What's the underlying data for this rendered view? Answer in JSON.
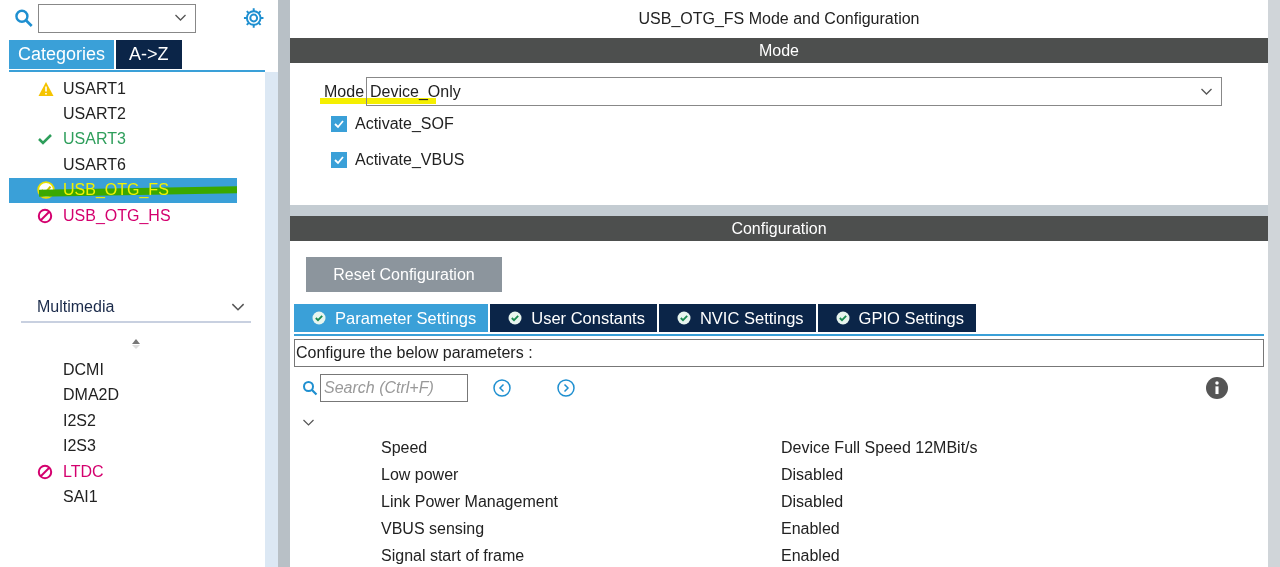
{
  "sidebar": {
    "tabs": [
      {
        "label": "Categories",
        "selected": true
      },
      {
        "label": "A->Z",
        "selected": false
      }
    ],
    "items": [
      {
        "label": "USART1",
        "kind": "warning",
        "selected": false,
        "highlighted": false
      },
      {
        "label": "USART2",
        "kind": "plain",
        "selected": false,
        "highlighted": false
      },
      {
        "label": "USART3",
        "kind": "ok",
        "selected": false,
        "highlighted": false
      },
      {
        "label": "USART6",
        "kind": "plain",
        "selected": false,
        "highlighted": false
      },
      {
        "label": "USB_OTG_FS",
        "kind": "ok",
        "selected": true,
        "highlighted": true
      },
      {
        "label": "USB_OTG_HS",
        "kind": "blocked",
        "selected": false,
        "highlighted": false
      }
    ],
    "group": {
      "label": "Multimedia",
      "expanded": true,
      "items": [
        {
          "label": "DCMI",
          "kind": "plain"
        },
        {
          "label": "DMA2D",
          "kind": "plain"
        },
        {
          "label": "I2S2",
          "kind": "plain"
        },
        {
          "label": "I2S3",
          "kind": "plain"
        },
        {
          "label": "LTDC",
          "kind": "blocked"
        },
        {
          "label": "SAI1",
          "kind": "plain"
        }
      ]
    }
  },
  "title": "USB_OTG_FS Mode and Configuration",
  "mode": {
    "header": "Mode",
    "label": "Mode",
    "value": "Device_Only",
    "highlighted": true,
    "options": [
      {
        "label": "Activate_SOF",
        "checked": true
      },
      {
        "label": "Activate_VBUS",
        "checked": true
      }
    ]
  },
  "configuration": {
    "header": "Configuration",
    "reset_button": "Reset Configuration",
    "tabs": [
      {
        "label": "Parameter Settings",
        "selected": true
      },
      {
        "label": "User Constants",
        "selected": false
      },
      {
        "label": "NVIC Settings",
        "selected": false
      },
      {
        "label": "GPIO Settings",
        "selected": false
      }
    ],
    "hint": "Configure the below parameters :",
    "search": {
      "placeholder": "Search (Ctrl+F)"
    },
    "group_expanded": true,
    "parameters": [
      {
        "name": "Speed",
        "value": "Device Full Speed 12MBit/s"
      },
      {
        "name": "Low power",
        "value": "Disabled"
      },
      {
        "name": "Link Power Management",
        "value": "Disabled"
      },
      {
        "name": "VBUS sensing",
        "value": "Enabled"
      },
      {
        "name": "Signal start of frame",
        "value": "Enabled"
      }
    ]
  }
}
